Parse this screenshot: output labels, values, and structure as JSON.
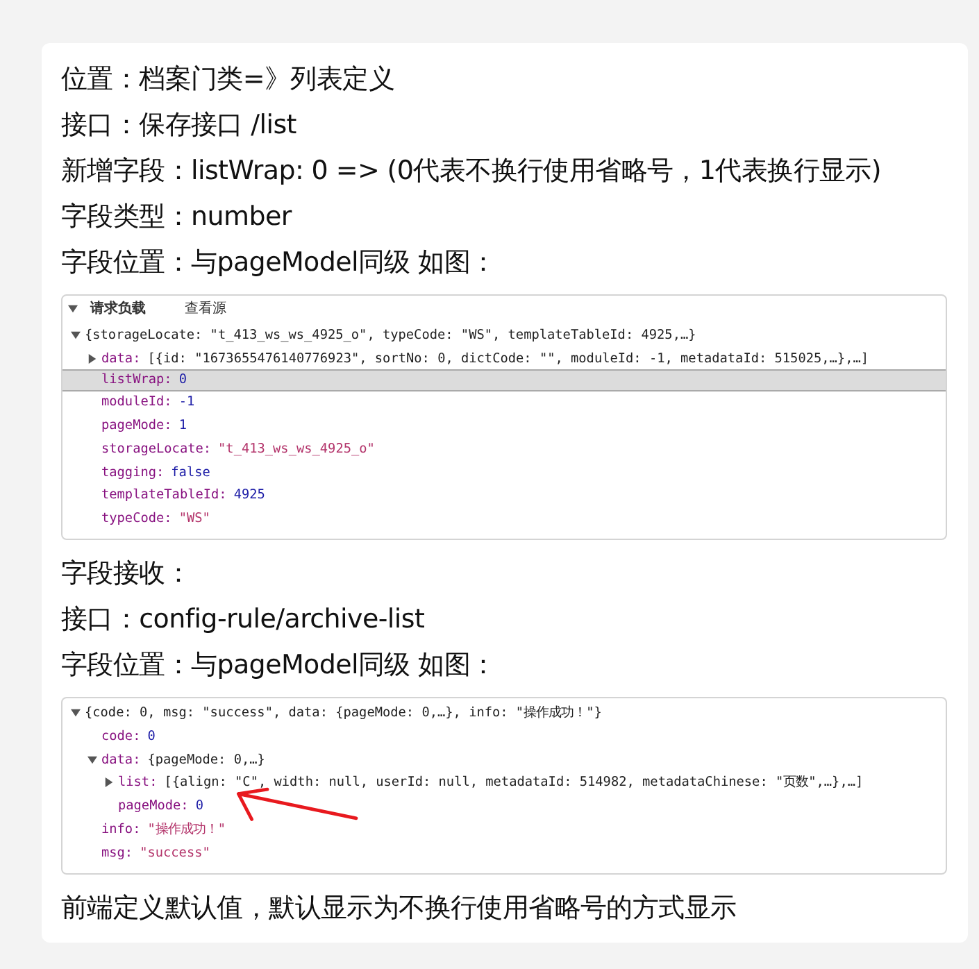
{
  "intro_lines": [
    "位置：档案门类=》列表定义",
    "接口：保存接口  /list",
    "新增字段：listWrap: 0 =>  (0代表不换行使用省略号，1代表换行显示)",
    "字段类型：number",
    "字段位置：与pageModel同级  如图："
  ],
  "request_panel": {
    "title": "请求负载",
    "view_source": "查看源",
    "tree": [
      {
        "value": "{storageLocate: \"t_413_ws_ws_4925_o\", typeCode: \"WS\", templateTableId: 4925,…}",
        "color": "#222222",
        "expanded": true,
        "highlighted": false,
        "children": [
          {
            "key": "data:",
            "value": "[{id: \"1673655476140776923\", sortNo: 0, dictCode: \"\", moduleId: -1, metadataId: 515025,…},…]",
            "color": "#222222",
            "expanded": false,
            "highlighted": false
          },
          {
            "key": "listWrap:",
            "value": "0",
            "color": "#1a1aa6",
            "highlighted": true
          },
          {
            "key": "moduleId:",
            "value": "-1",
            "color": "#1a1aa6",
            "highlighted": false
          },
          {
            "key": "pageMode:",
            "value": "1",
            "color": "#1a1aa6",
            "highlighted": false
          },
          {
            "key": "storageLocate:",
            "value": "\"t_413_ws_ws_4925_o\"",
            "color": "#b3336a",
            "highlighted": false
          },
          {
            "key": "tagging:",
            "value": "false",
            "color": "#1a1aa6",
            "highlighted": false
          },
          {
            "key": "templateTableId:",
            "value": "4925",
            "color": "#1a1aa6",
            "highlighted": false
          },
          {
            "key": "typeCode:",
            "value": "\"WS\"",
            "color": "#b3336a",
            "highlighted": false
          }
        ]
      }
    ]
  },
  "middle_lines": [
    "字段接收：",
    "接口：config-rule/archive-list",
    "字段位置：与pageModel同级  如图："
  ],
  "response_panel": {
    "tree": [
      {
        "value": "{code: 0, msg: \"success\", data: {pageMode: 0,…}, info: \"操作成功！\"}",
        "color": "#222222",
        "expanded": true,
        "highlighted": false,
        "children": [
          {
            "key": "code:",
            "value": "0",
            "color": "#1a1aa6",
            "highlighted": false
          },
          {
            "key": "data:",
            "value": "{pageMode: 0,…}",
            "color": "#222222",
            "expanded": true,
            "highlighted": false,
            "children": [
              {
                "key": "list:",
                "value": "[{align: \"C\", width: null, userId: null, metadataId: 514982, metadataChinese: \"页数\",…},…]",
                "color": "#222222",
                "expanded": false,
                "highlighted": false
              },
              {
                "key": "pageMode:",
                "value": "0",
                "color": "#1a1aa6",
                "highlighted": false
              }
            ]
          },
          {
            "key": "info:",
            "value": "\"操作成功！\"",
            "color": "#b3336a",
            "highlighted": false
          },
          {
            "key": "msg:",
            "value": "\"success\"",
            "color": "#b3336a",
            "highlighted": false
          }
        ]
      }
    ]
  },
  "footer_line": "前端定义默认值，默认显示为不换行使用省略号的方式显示"
}
